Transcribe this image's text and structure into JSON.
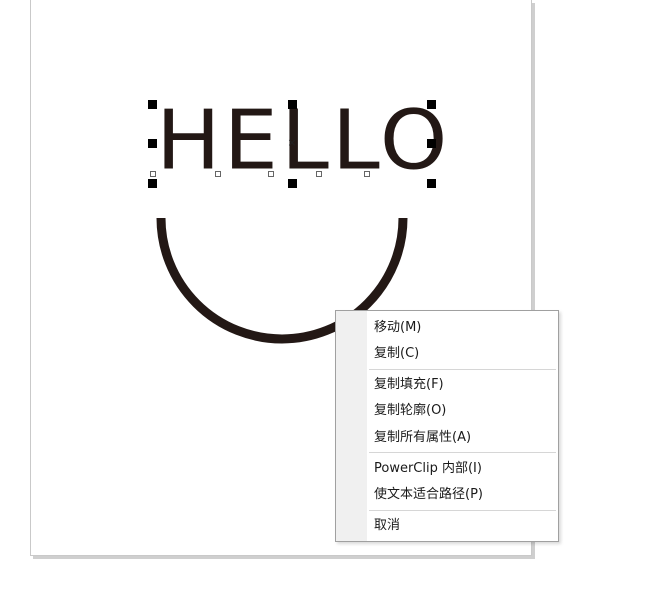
{
  "canvas": {
    "artwork_text": "HELLO",
    "text_color": "#231815",
    "selection_center_glyph": "×"
  },
  "context_menu": {
    "groups": [
      [
        {
          "label": "移动(M)"
        },
        {
          "label": "复制(C)"
        }
      ],
      [
        {
          "label": "复制填充(F)"
        },
        {
          "label": "复制轮廓(O)"
        },
        {
          "label": "复制所有属性(A)"
        }
      ],
      [
        {
          "label": "PowerClip 内部(I)"
        },
        {
          "label": "使文本适合路径(P)"
        }
      ],
      [
        {
          "label": "取消"
        }
      ]
    ]
  }
}
